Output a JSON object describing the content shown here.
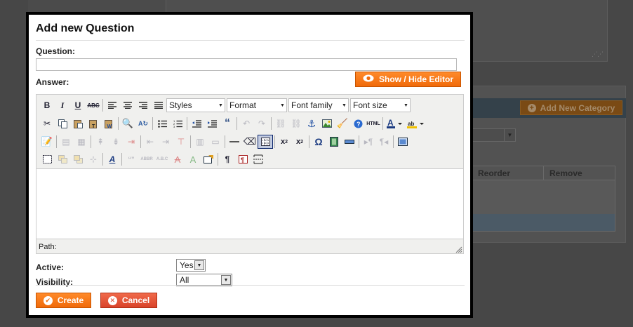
{
  "background": {
    "add_category_label": "Add New Category",
    "columns": [
      "Reorder",
      "Remove"
    ]
  },
  "modal": {
    "title": "Add new Question",
    "question_label": "Question:",
    "question_value": "",
    "answer_label": "Answer:",
    "toggle_editor_label": "Show / Hide Editor",
    "editor": {
      "styles_label": "Styles",
      "format_label": "Format",
      "font_family_label": "Font family",
      "font_size_label": "Font size",
      "path_label": "Path:",
      "html_label": "HTML"
    },
    "active_label": "Active:",
    "active_value": "Yes",
    "visibility_label": "Visibility:",
    "visibility_value": "All",
    "create_label": "Create",
    "cancel_label": "Cancel"
  },
  "colors": {
    "accent_orange": "#f47a1a",
    "cancel_red": "#e2533a",
    "overlay": "#474747"
  }
}
